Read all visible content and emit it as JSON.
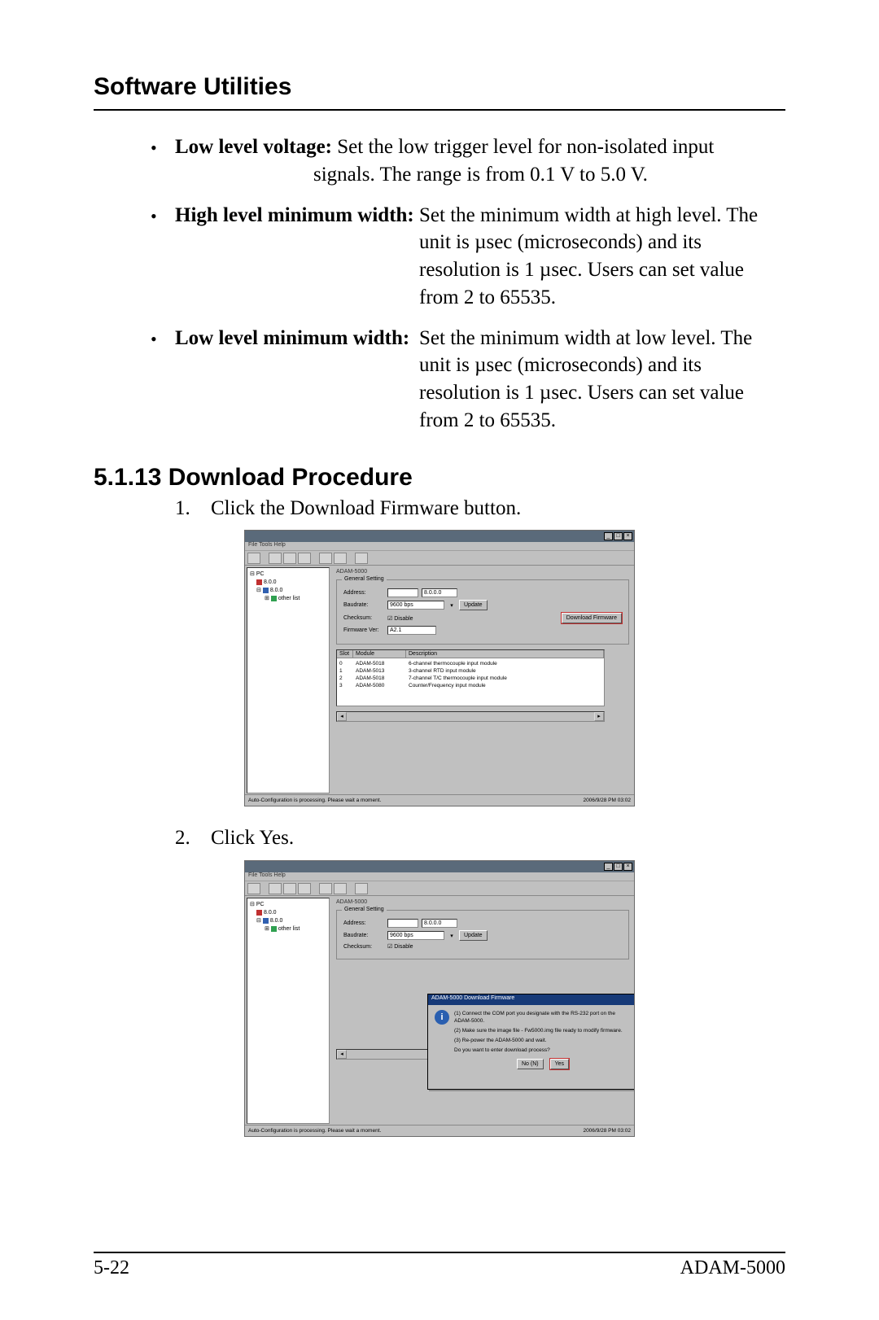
{
  "header": {
    "title": "Software Utilities"
  },
  "bullets": [
    {
      "term": "Low level voltage:",
      "desc_inline": " Set the low trigger level for non-isolated input",
      "cont": "signals. The range is from 0.1 V to 5.0 V."
    },
    {
      "term": "High level minimum width:",
      "desc": "Set the minimum width at high level. The unit is µsec (microseconds) and its resolution is 1 µsec. Users can set value from 2 to 65535."
    },
    {
      "term": "Low level minimum width:",
      "desc": "Set the minimum width at low level. The unit is µsec (microseconds) and its resolution is 1 µsec. Users can set value from 2 to 65535."
    }
  ],
  "section": {
    "heading": "5.1.13 Download Procedure"
  },
  "steps": [
    {
      "num": "1.",
      "text": "Click the Download Firmware button."
    },
    {
      "num": "2.",
      "text": "Click Yes."
    }
  ],
  "app": {
    "menu": "File  Tools  Help",
    "tree": {
      "root": "PC",
      "n1": "8.0.0",
      "n2": "8.0.0",
      "n3": "other list"
    },
    "crumb": "ADAM-5000",
    "group": "General Setting",
    "fields": {
      "address_l": "Address:",
      "address_v": "8.0.0.0",
      "baud_l": "Baudrate:",
      "baud_v": "9600 bps",
      "check_l": "Checksum:",
      "check_v": "Disable",
      "fw_l": "Firmware Ver:",
      "fw_v": "A2.1"
    },
    "buttons": {
      "update": "Update",
      "download": "Download Firmware"
    },
    "table": {
      "h_slot": "Slot",
      "h_mod": "Module",
      "h_desc": "Description",
      "rows": [
        {
          "s": "0",
          "m": "ADAM-5018",
          "d": "6-channel thermocouple input module"
        },
        {
          "s": "1",
          "m": "ADAM-5013",
          "d": "3-channel RTD input module"
        },
        {
          "s": "2",
          "m": "ADAM-5018",
          "d": "7-channel T/C thermocouple input module"
        },
        {
          "s": "3",
          "m": "ADAM-5080",
          "d": "Counter/Frequency input module"
        }
      ]
    },
    "status_left": "Auto-Configuration is processing. Please wait a moment.",
    "status_right": "2006/9/28   PM 03:02"
  },
  "dialog": {
    "title": "ADAM-5000 Download Firmware",
    "line1": "(1) Connect the COM port you designate with the RS-232 port on the ADAM-5000.",
    "line2": "(2) Make sure the image file - Fw5000.img file ready to modify firmware.",
    "line3": "(3) Re-power the ADAM-5000 and wait.",
    "line4": "Do you want to enter download process?",
    "no": "No (N)",
    "yes": "Yes"
  },
  "footer": {
    "page": "5-22",
    "doc": "ADAM-5000"
  }
}
